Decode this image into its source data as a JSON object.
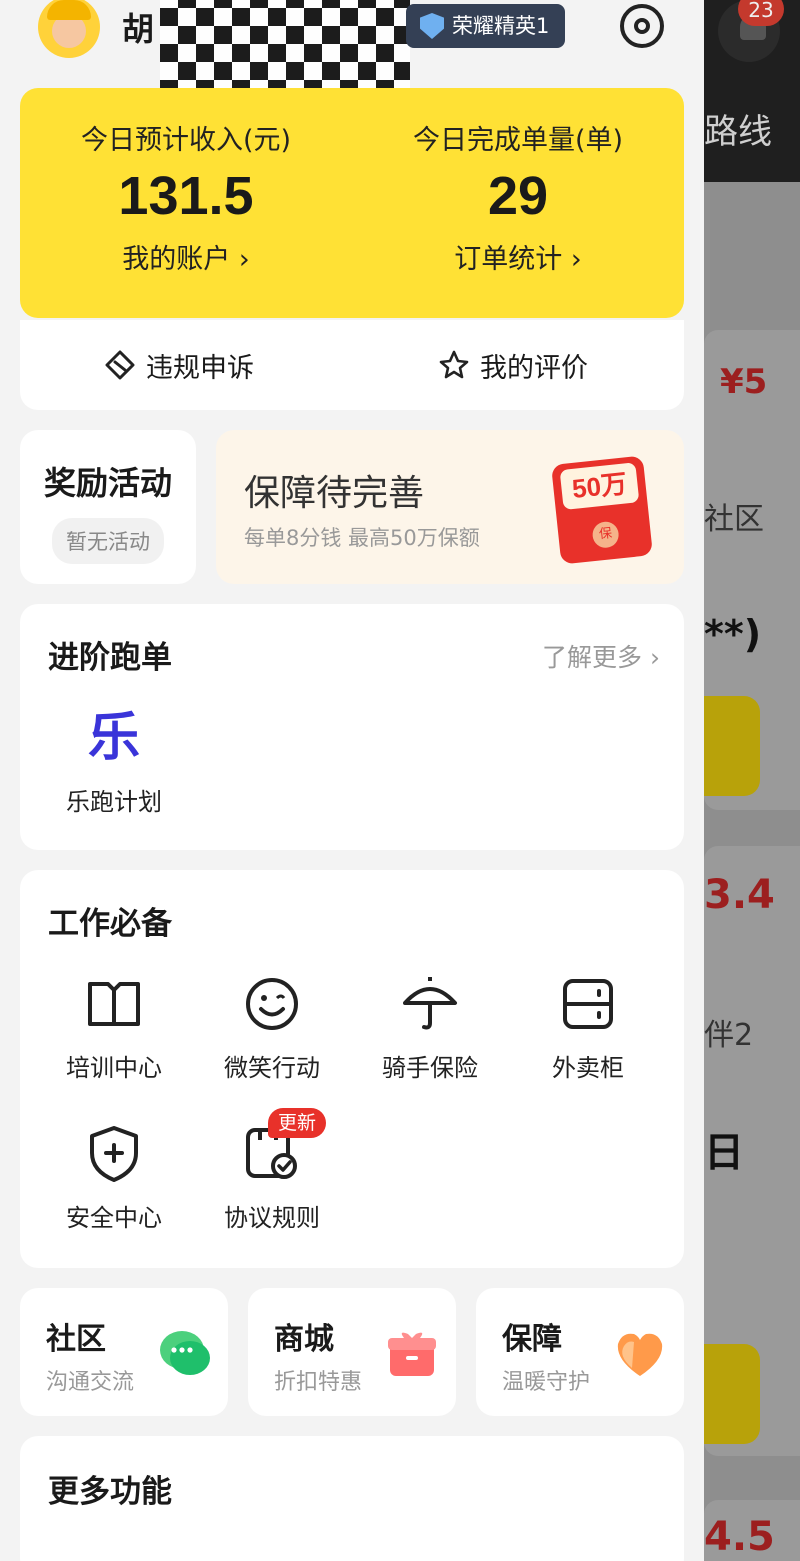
{
  "header": {
    "user_name": "胡",
    "rank_badge": "荣耀精英1"
  },
  "income": {
    "expected_label": "今日预计收入(元)",
    "expected_value": "131.5",
    "account_link": "我的账户 ›",
    "orders_label": "今日完成单量(单)",
    "orders_value": "29",
    "stats_link": "订单统计 ›"
  },
  "actions": {
    "appeal": "违规申诉",
    "rating": "我的评价"
  },
  "reward": {
    "title": "奖励活动",
    "status": "暂无活动"
  },
  "insurance_promo": {
    "title": "保障待完善",
    "subtitle": "每单8分钱 最高50万保额",
    "amount": "50万",
    "seal": "保"
  },
  "advanced": {
    "title": "进阶跑单",
    "more": "了解更多 ›",
    "items": [
      {
        "icon_text": "乐",
        "label": "乐跑计划"
      }
    ]
  },
  "work": {
    "title": "工作必备",
    "items": [
      {
        "label": "培训中心",
        "icon": "book-icon"
      },
      {
        "label": "微笑行动",
        "icon": "smile-icon"
      },
      {
        "label": "骑手保险",
        "icon": "umbrella-icon"
      },
      {
        "label": "外卖柜",
        "icon": "locker-icon"
      },
      {
        "label": "安全中心",
        "icon": "shield-plus-icon"
      },
      {
        "label": "协议规则",
        "icon": "agreement-icon"
      }
    ],
    "update_badge": "更新"
  },
  "shortcuts": [
    {
      "title": "社区",
      "subtitle": "沟通交流"
    },
    {
      "title": "商城",
      "subtitle": "折扣特惠"
    },
    {
      "title": "保障",
      "subtitle": "温暖守护"
    }
  ],
  "more_functions": {
    "title": "更多功能"
  },
  "background_app": {
    "notification_count": "23",
    "tab_fragment": "路线",
    "price_1": "¥5",
    "community_fragment": "社区",
    "masked_fragment": "**)",
    "price_2": "3.4",
    "companion_fragment": "伴2",
    "glyph_fragment": "日",
    "price_3": "4.5"
  },
  "colors": {
    "accent_yellow": "#ffe135",
    "badge_navy": "#344055",
    "red": "#e8312a",
    "purple": "#3a34d9"
  }
}
